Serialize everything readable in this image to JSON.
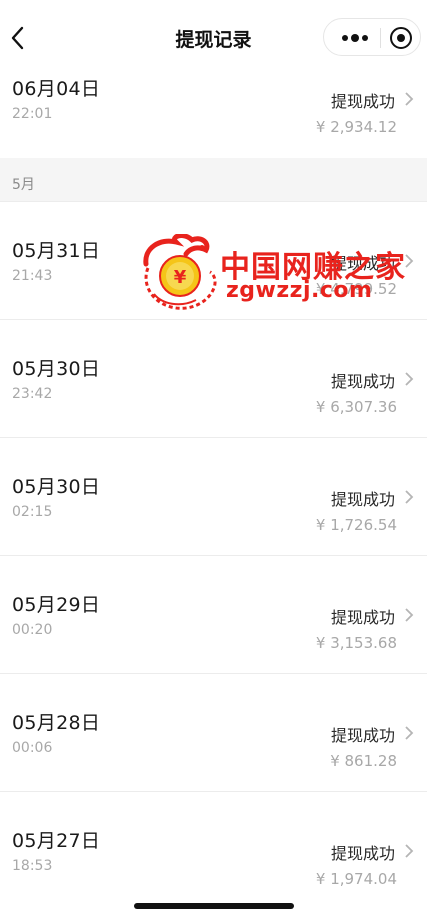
{
  "header": {
    "title": "提现记录",
    "back_icon": "chevron-left-icon",
    "more_icon": "more-dots-icon",
    "close_icon": "target-close-icon"
  },
  "records": [
    {
      "date": "06月04日",
      "time": "22:01",
      "status": "提现成功",
      "amount": "¥ 2,934.12"
    },
    {
      "date": "05月31日",
      "time": "21:43",
      "status": "提现成功",
      "amount": "¥ 4,799.52"
    },
    {
      "date": "05月30日",
      "time": "23:42",
      "status": "提现成功",
      "amount": "¥ 6,307.36"
    },
    {
      "date": "05月30日",
      "time": "02:15",
      "status": "提现成功",
      "amount": "¥ 1,726.54"
    },
    {
      "date": "05月29日",
      "time": "00:20",
      "status": "提现成功",
      "amount": "¥ 3,153.68"
    },
    {
      "date": "05月28日",
      "time": "00:06",
      "status": "提现成功",
      "amount": "¥ 861.28"
    },
    {
      "date": "05月27日",
      "time": "18:53",
      "status": "提现成功",
      "amount": "¥ 1,974.04"
    }
  ],
  "month_header": {
    "label": "5月"
  },
  "watermark": {
    "title": "中国网赚之家",
    "url": "zgwzzj.com",
    "logo_icon": "dragon-coin-logo-icon"
  },
  "colors": {
    "watermark_red": "#e8231d",
    "coin_gold": "#f5c518",
    "muted_text": "#a8a8a8",
    "month_bg": "#f5f5f5"
  }
}
